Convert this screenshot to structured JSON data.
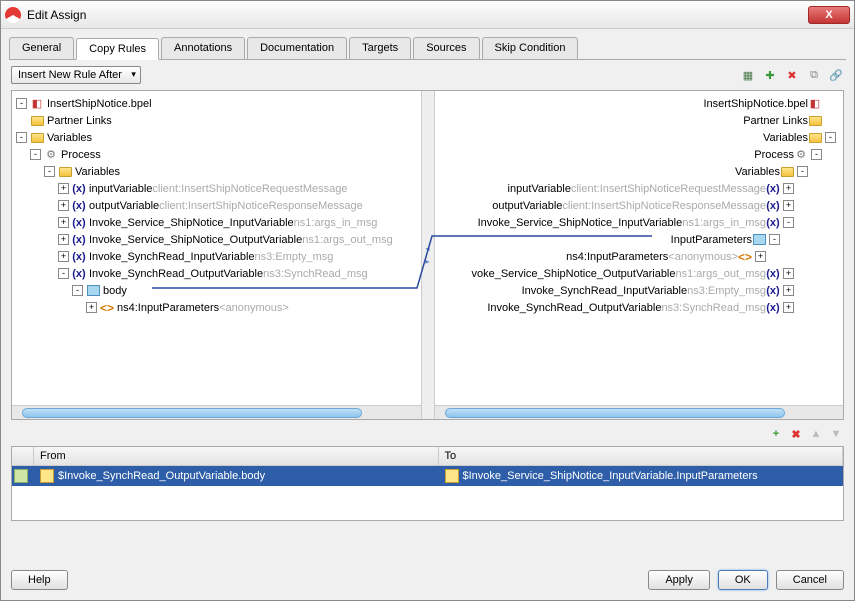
{
  "dialog": {
    "title": "Edit Assign"
  },
  "tabs": [
    "General",
    "Copy Rules",
    "Annotations",
    "Documentation",
    "Targets",
    "Sources",
    "Skip Condition"
  ],
  "active_tab": 1,
  "toolbar": {
    "dropdown": "Insert New Rule After"
  },
  "left_tree": {
    "root": "InsertShipNotice.bpel",
    "items": [
      {
        "indent": 0,
        "exp": "-",
        "icon": "bpel",
        "label": "InsertShipNotice.bpel"
      },
      {
        "indent": 0,
        "exp": "",
        "icon": "folder",
        "label": "Partner Links"
      },
      {
        "indent": 0,
        "exp": "-",
        "icon": "folder",
        "label": "Variables"
      },
      {
        "indent": 1,
        "exp": "-",
        "icon": "gear",
        "label": "Process"
      },
      {
        "indent": 2,
        "exp": "-",
        "icon": "folder",
        "label": "Variables"
      },
      {
        "indent": 3,
        "exp": "+",
        "icon": "var",
        "label": "inputVariable",
        "suffix": "client:InsertShipNoticeRequestMessage"
      },
      {
        "indent": 3,
        "exp": "+",
        "icon": "var",
        "label": "outputVariable",
        "suffix": "client:InsertShipNoticeResponseMessage"
      },
      {
        "indent": 3,
        "exp": "+",
        "icon": "var",
        "label": "Invoke_Service_ShipNotice_InputVariable",
        "suffix": "ns1:args_in_msg"
      },
      {
        "indent": 3,
        "exp": "+",
        "icon": "var",
        "label": "Invoke_Service_ShipNotice_OutputVariable",
        "suffix": "ns1:args_out_msg"
      },
      {
        "indent": 3,
        "exp": "+",
        "icon": "var",
        "label": "Invoke_SynchRead_InputVariable",
        "suffix": "ns3:Empty_msg"
      },
      {
        "indent": 3,
        "exp": "-",
        "icon": "var",
        "label": "Invoke_SynchRead_OutputVariable",
        "suffix": "ns3:SynchRead_msg"
      },
      {
        "indent": 4,
        "exp": "-",
        "icon": "body",
        "label": "body"
      },
      {
        "indent": 5,
        "exp": "+",
        "icon": "ns",
        "label": "ns4:InputParameters",
        "suffix": "<anonymous>"
      }
    ]
  },
  "right_tree": {
    "items": [
      {
        "indent": 0,
        "exp": "",
        "icon": "bpel",
        "label": "InsertShipNotice.bpel"
      },
      {
        "indent": 0,
        "exp": "",
        "icon": "folder",
        "label": "Partner Links"
      },
      {
        "indent": 0,
        "exp": "-",
        "icon": "folder",
        "label": "Variables"
      },
      {
        "indent": 1,
        "exp": "-",
        "icon": "gear",
        "label": "Process"
      },
      {
        "indent": 2,
        "exp": "-",
        "icon": "folder",
        "label": "Variables"
      },
      {
        "indent": 3,
        "exp": "+",
        "icon": "var",
        "label": "inputVariable",
        "suffix": "client:InsertShipNoticeRequestMessage"
      },
      {
        "indent": 3,
        "exp": "+",
        "icon": "var",
        "label": "outputVariable",
        "suffix": "client:InsertShipNoticeResponseMessage"
      },
      {
        "indent": 3,
        "exp": "-",
        "icon": "var",
        "label": "Invoke_Service_ShipNotice_InputVariable",
        "suffix": "ns1:args_in_msg"
      },
      {
        "indent": 4,
        "exp": "-",
        "icon": "body",
        "label": "InputParameters"
      },
      {
        "indent": 5,
        "exp": "+",
        "icon": "ns",
        "label": "ns4:InputParameters",
        "suffix": "<anonymous>"
      },
      {
        "indent": 3,
        "exp": "+",
        "icon": "var",
        "label": "voke_Service_ShipNotice_OutputVariable",
        "suffix": "ns1:args_out_msg"
      },
      {
        "indent": 3,
        "exp": "+",
        "icon": "var",
        "label": "Invoke_SynchRead_InputVariable",
        "suffix": "ns3:Empty_msg"
      },
      {
        "indent": 3,
        "exp": "+",
        "icon": "var",
        "label": "Invoke_SynchRead_OutputVariable",
        "suffix": "ns3:SynchRead_msg"
      }
    ]
  },
  "table": {
    "headers": [
      "From",
      "To"
    ],
    "rows": [
      {
        "from": "$Invoke_SynchRead_OutputVariable.body",
        "to": "$Invoke_Service_ShipNotice_InputVariable.InputParameters"
      }
    ]
  },
  "footer": {
    "help": "Help",
    "apply": "Apply",
    "ok": "OK",
    "cancel": "Cancel"
  }
}
